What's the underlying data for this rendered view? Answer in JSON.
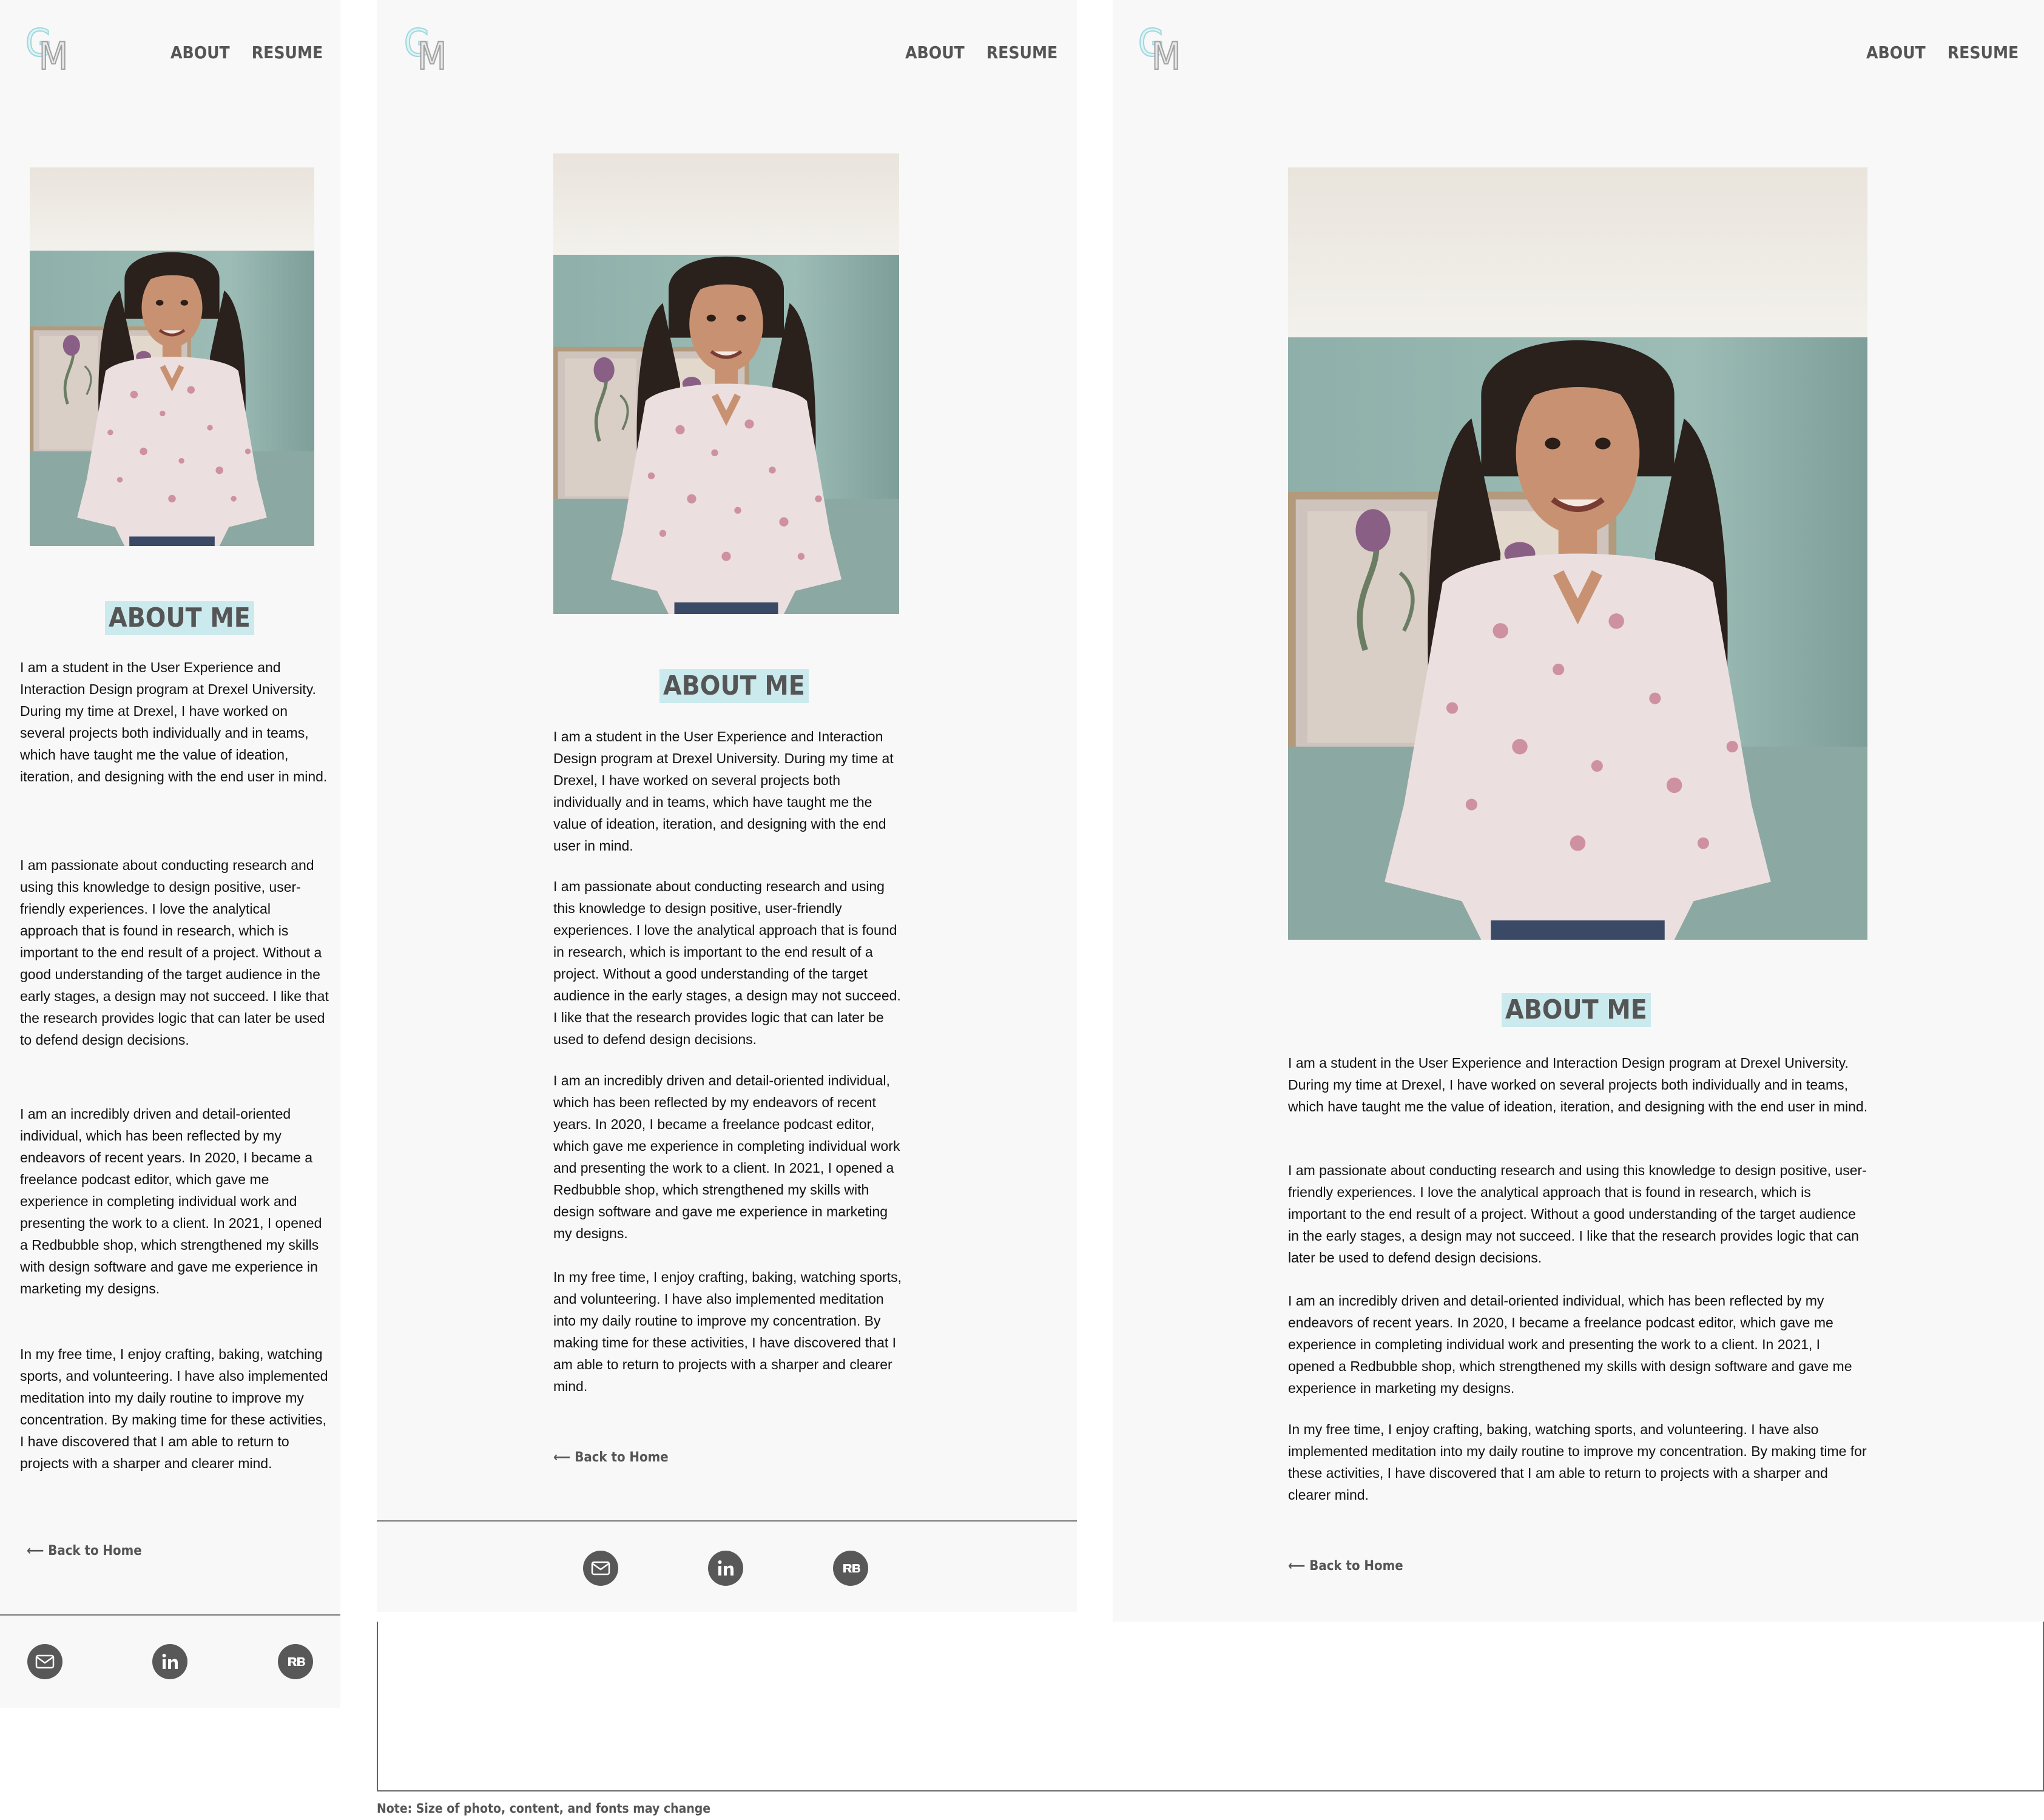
{
  "logo": {
    "letter1": "G",
    "letter2": "M"
  },
  "nav": {
    "about": "ABOUT",
    "resume": "RESUME"
  },
  "heading": "ABOUT ME",
  "paragraphs": [
    "I am a student in the User Experience and Interaction Design program at Drexel University. During my time at Drexel, I have worked on several projects both individually and in teams, which have taught me the value of ideation, iteration, and designing with the end user in mind.",
    "I am passionate about conducting research and using this knowledge to design positive, user-friendly experiences. I love the analytical approach that is found in research, which is important to the end result of a project. Without a good understanding of the target audience in the early stages, a design may not succeed. I like that the research provides logic that can later be used to defend design decisions.",
    "I am an incredibly driven and detail-oriented individual, which has been reflected by my endeavors of recent years. In 2020, I became a freelance podcast editor, which gave me experience in completing individual work and presenting the work to a client. In 2021, I opened a Redbubble shop, which strengthened my skills with design software and gave me experience in marketing my designs.",
    "In my free time, I enjoy crafting, baking, watching sports, and volunteering. I have also implemented meditation into my daily routine to improve my concentration. By making time for these activities, I have discovered that I am able to return to projects with a sharper and clearer mind."
  ],
  "back_link": "⟵ Back to Home",
  "footer_icons": [
    "email-icon",
    "linkedin-icon",
    "redbubble-icon"
  ],
  "note": "Note: Size of photo, content, and fonts may change",
  "colors": {
    "heading_bg": "#cbeaed",
    "frame_bg": "#f8f8f8",
    "icon": "#585858",
    "logo_accent": "#9fd8de"
  }
}
